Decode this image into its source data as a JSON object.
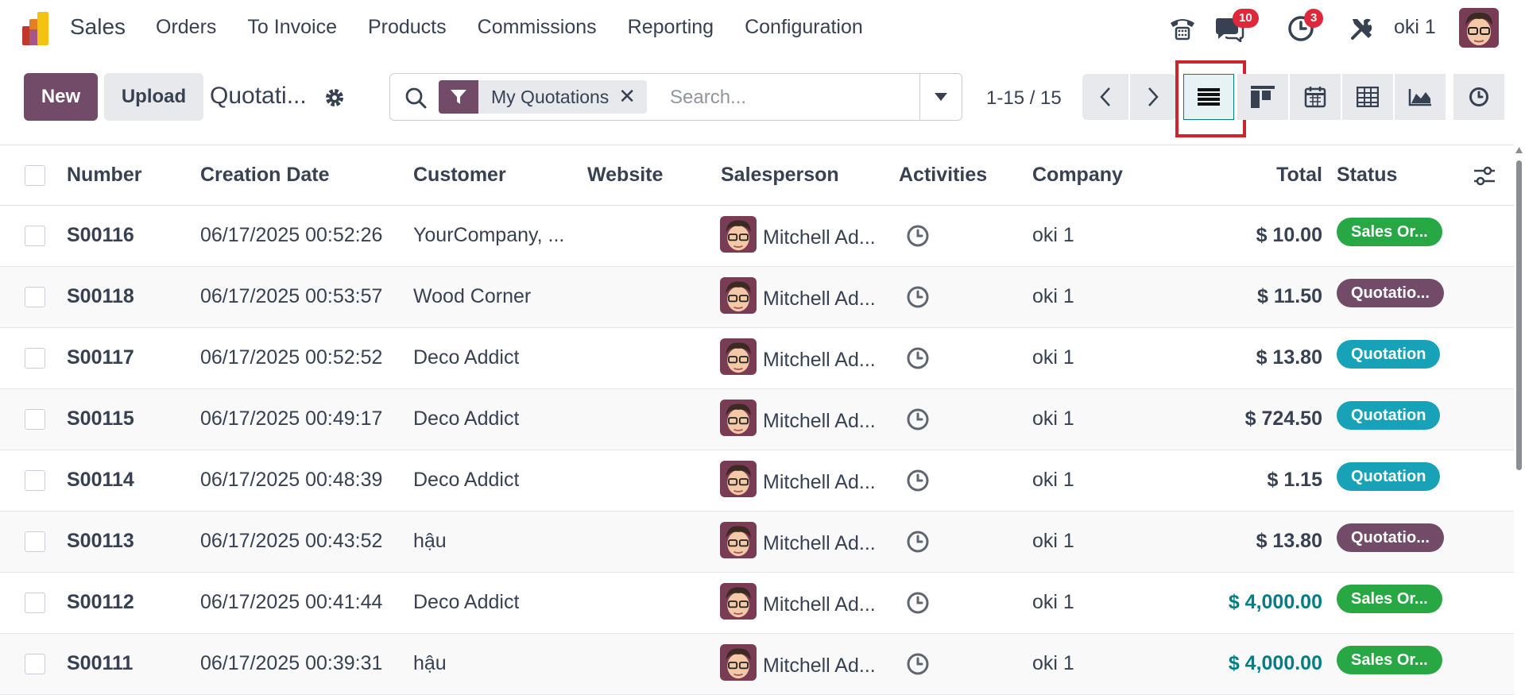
{
  "navbar": {
    "app_name": "Sales",
    "menu": [
      "Orders",
      "To Invoice",
      "Products",
      "Commissions",
      "Reporting",
      "Configuration"
    ],
    "messages_count": "10",
    "activities_count": "3",
    "user_name": "oki 1"
  },
  "control": {
    "new_label": "New",
    "upload_label": "Upload",
    "breadcrumb": "Quotati...",
    "facet_label": "My Quotations",
    "facet_close": "✕",
    "search_placeholder": "Search...",
    "pager": "1-15 / 15"
  },
  "table": {
    "headers": {
      "number": "Number",
      "creation_date": "Creation Date",
      "customer": "Customer",
      "website": "Website",
      "salesperson": "Salesperson",
      "activities": "Activities",
      "company": "Company",
      "total": "Total",
      "status": "Status"
    },
    "rows": [
      {
        "number": "S00116",
        "date": "06/17/2025 00:52:26",
        "customer": "YourCompany, ...",
        "salesperson": "Mitchell Ad...",
        "company": "oki 1",
        "total": "$ 10.00",
        "status": "Sales Or..."
      },
      {
        "number": "S00118",
        "date": "06/17/2025 00:53:57",
        "customer": "Wood Corner",
        "salesperson": "Mitchell Ad...",
        "company": "oki 1",
        "total": "$ 11.50",
        "status": "Quotatio..."
      },
      {
        "number": "S00117",
        "date": "06/17/2025 00:52:52",
        "customer": "Deco Addict",
        "salesperson": "Mitchell Ad...",
        "company": "oki 1",
        "total": "$ 13.80",
        "status": "Quotation"
      },
      {
        "number": "S00115",
        "date": "06/17/2025 00:49:17",
        "customer": "Deco Addict",
        "salesperson": "Mitchell Ad...",
        "company": "oki 1",
        "total": "$ 724.50",
        "status": "Quotation"
      },
      {
        "number": "S00114",
        "date": "06/17/2025 00:48:39",
        "customer": "Deco Addict",
        "salesperson": "Mitchell Ad...",
        "company": "oki 1",
        "total": "$ 1.15",
        "status": "Quotation"
      },
      {
        "number": "S00113",
        "date": "06/17/2025 00:43:52",
        "customer": "hậu",
        "salesperson": "Mitchell Ad...",
        "company": "oki 1",
        "total": "$ 13.80",
        "status": "Quotatio..."
      },
      {
        "number": "S00112",
        "date": "06/17/2025 00:41:44",
        "customer": "Deco Addict",
        "salesperson": "Mitchell Ad...",
        "company": "oki 1",
        "total": "$ 4,000.00",
        "status": "Sales Or..."
      },
      {
        "number": "S00111",
        "date": "06/17/2025 00:39:31",
        "customer": "hậu",
        "salesperson": "Mitchell Ad...",
        "company": "oki 1",
        "total": "$ 4,000.00",
        "status": "Sales Or..."
      }
    ]
  },
  "colors": {
    "brand": "#714b67",
    "teal": "#017e84",
    "status_sales": "#28a745",
    "status_quotation": "#17a2b8",
    "highlight": "#d1232a"
  }
}
